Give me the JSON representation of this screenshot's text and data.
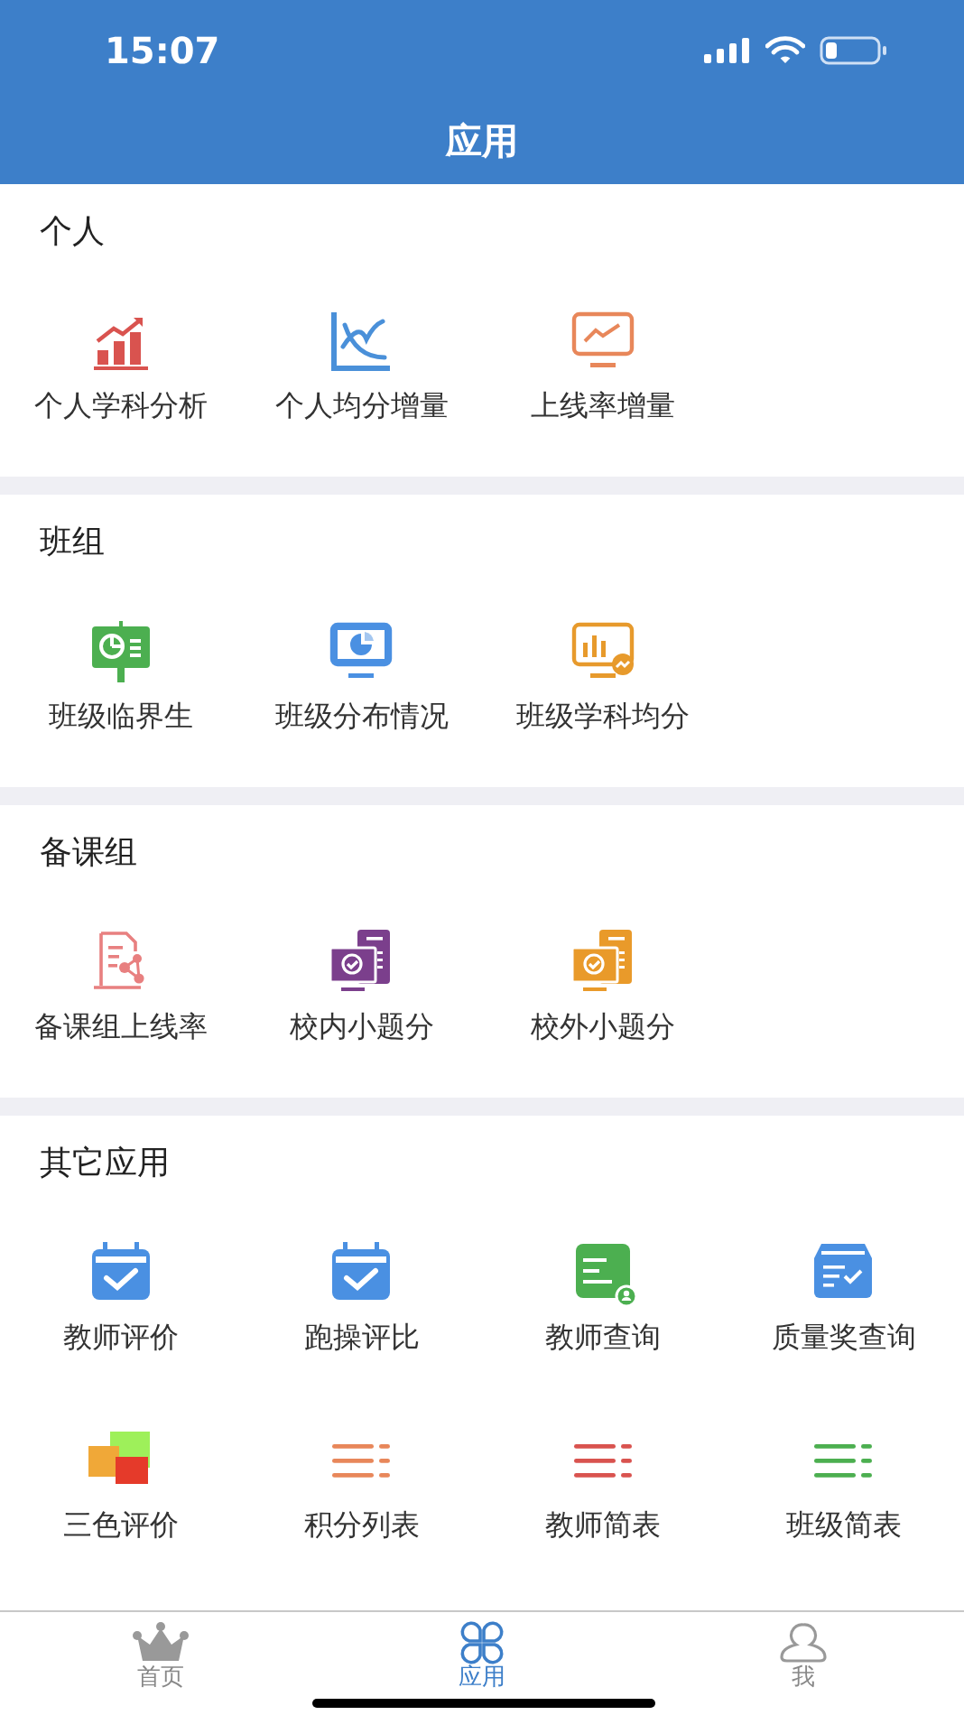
{
  "status_bar": {
    "time": "15:07"
  },
  "header": {
    "title": "应用"
  },
  "sections": [
    {
      "title": "个人",
      "items": [
        {
          "label": "个人学科分析",
          "kind": "growth-chart",
          "color": "#d9534f"
        },
        {
          "label": "个人均分增量",
          "kind": "curve-chart",
          "color": "#4a90d9"
        },
        {
          "label": "上线率增量",
          "kind": "monitor-line",
          "color": "#e8875a"
        }
      ]
    },
    {
      "title": "班组",
      "items": [
        {
          "label": "班级临界生",
          "kind": "easel",
          "color": "#4caf50"
        },
        {
          "label": "班级分布情况",
          "kind": "monitor-pie",
          "color": "#4a90e2"
        },
        {
          "label": "班级学科均分",
          "kind": "monitor-bars",
          "color": "#e79a2c"
        }
      ]
    },
    {
      "title": "备课组",
      "items": [
        {
          "label": "备课组上线率",
          "kind": "document-network",
          "color": "#e88080"
        },
        {
          "label": "校内小题分",
          "kind": "computer-check",
          "color": "#7b3f8c"
        },
        {
          "label": "校外小题分",
          "kind": "computer-check",
          "color": "#e99a2a"
        }
      ]
    },
    {
      "title": "其它应用",
      "items": [
        {
          "label": "教师评价",
          "kind": "calendar-check",
          "color": "#4a90e2"
        },
        {
          "label": "跑操评比",
          "kind": "calendar-check",
          "color": "#4a90e2"
        },
        {
          "label": "教师查询",
          "kind": "card-user",
          "color": "#4caf50"
        },
        {
          "label": "质量奖查询",
          "kind": "tray-check",
          "color": "#4a90e2"
        },
        {
          "label": "三色评价",
          "kind": "color-squares",
          "color": "#e53a2a"
        },
        {
          "label": "积分列表",
          "kind": "list",
          "color": "#e8875a"
        },
        {
          "label": "教师简表",
          "kind": "list",
          "color": "#d9534f"
        },
        {
          "label": "班级简表",
          "kind": "list",
          "color": "#4caf50"
        }
      ]
    }
  ],
  "tab_bar": [
    {
      "label": "首页",
      "kind": "crown",
      "selected": false
    },
    {
      "label": "应用",
      "kind": "clover",
      "selected": true
    },
    {
      "label": "我",
      "kind": "person",
      "selected": false
    }
  ]
}
